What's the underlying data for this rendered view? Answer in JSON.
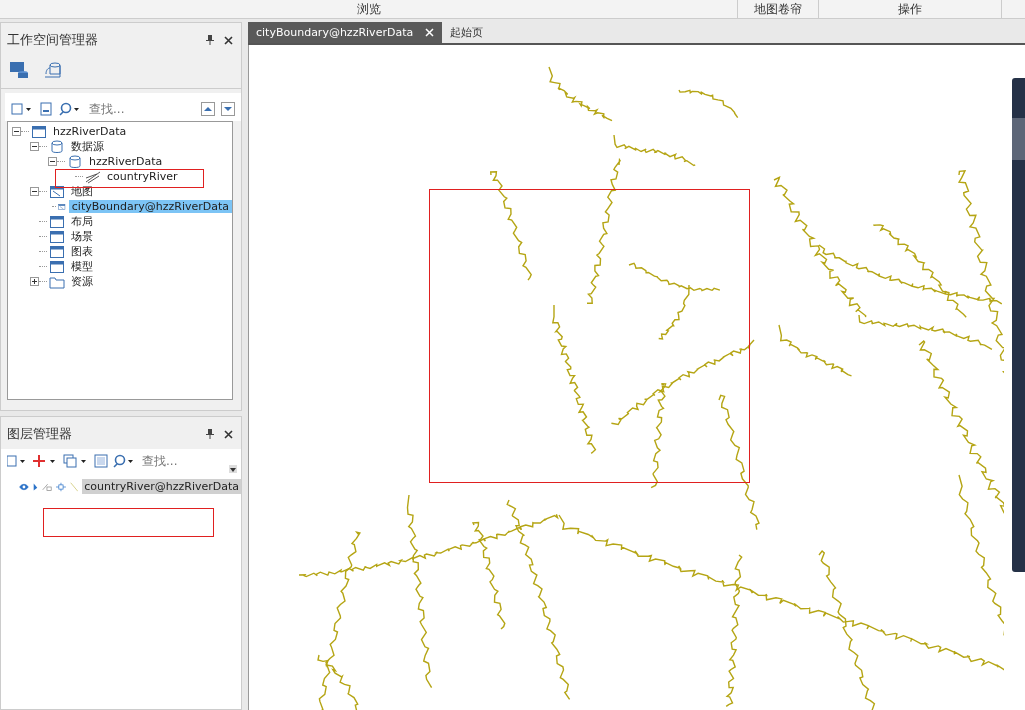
{
  "ribbon_groups": [
    "浏览",
    "地图卷帘",
    "操作"
  ],
  "workspace_panel": {
    "title": "工作空间管理器",
    "search": {
      "placeholder": "查找..."
    },
    "tree": [
      {
        "label": "hzzRiverData",
        "kind": "workspace",
        "expanded": true,
        "selected": false,
        "children": [
          {
            "label": "数据源",
            "kind": "datasources",
            "expanded": true,
            "selected": false,
            "children": [
              {
                "label": "hzzRiverData",
                "kind": "udb",
                "expanded": true,
                "selected": false,
                "children": [
                  {
                    "label": "countryRiver",
                    "kind": "line",
                    "selected": false
                  }
                ]
              }
            ]
          },
          {
            "label": "地图",
            "kind": "maps",
            "expanded": true,
            "selected": false,
            "children": [
              {
                "label": "cityBoundary@hzzRiverData",
                "kind": "map",
                "selected": true
              }
            ]
          },
          {
            "label": "布局",
            "kind": "layouts",
            "selected": false
          },
          {
            "label": "场景",
            "kind": "scenes",
            "selected": false
          },
          {
            "label": "图表",
            "kind": "charts",
            "selected": false
          },
          {
            "label": "模型",
            "kind": "models",
            "selected": false
          },
          {
            "label": "资源",
            "kind": "resources",
            "expanded": false,
            "selected": false
          }
        ]
      }
    ]
  },
  "layer_panel": {
    "title": "图层管理器",
    "search": {
      "placeholder": "查找..."
    },
    "layers": [
      {
        "name": "countryRiver@hzzRiverData",
        "visible": true,
        "selected": true
      }
    ]
  },
  "tabs": [
    {
      "label": "cityBoundary@hzzRiverData",
      "selected": true,
      "closable": true
    },
    {
      "label": "起始页",
      "selected": false,
      "closable": false
    }
  ]
}
